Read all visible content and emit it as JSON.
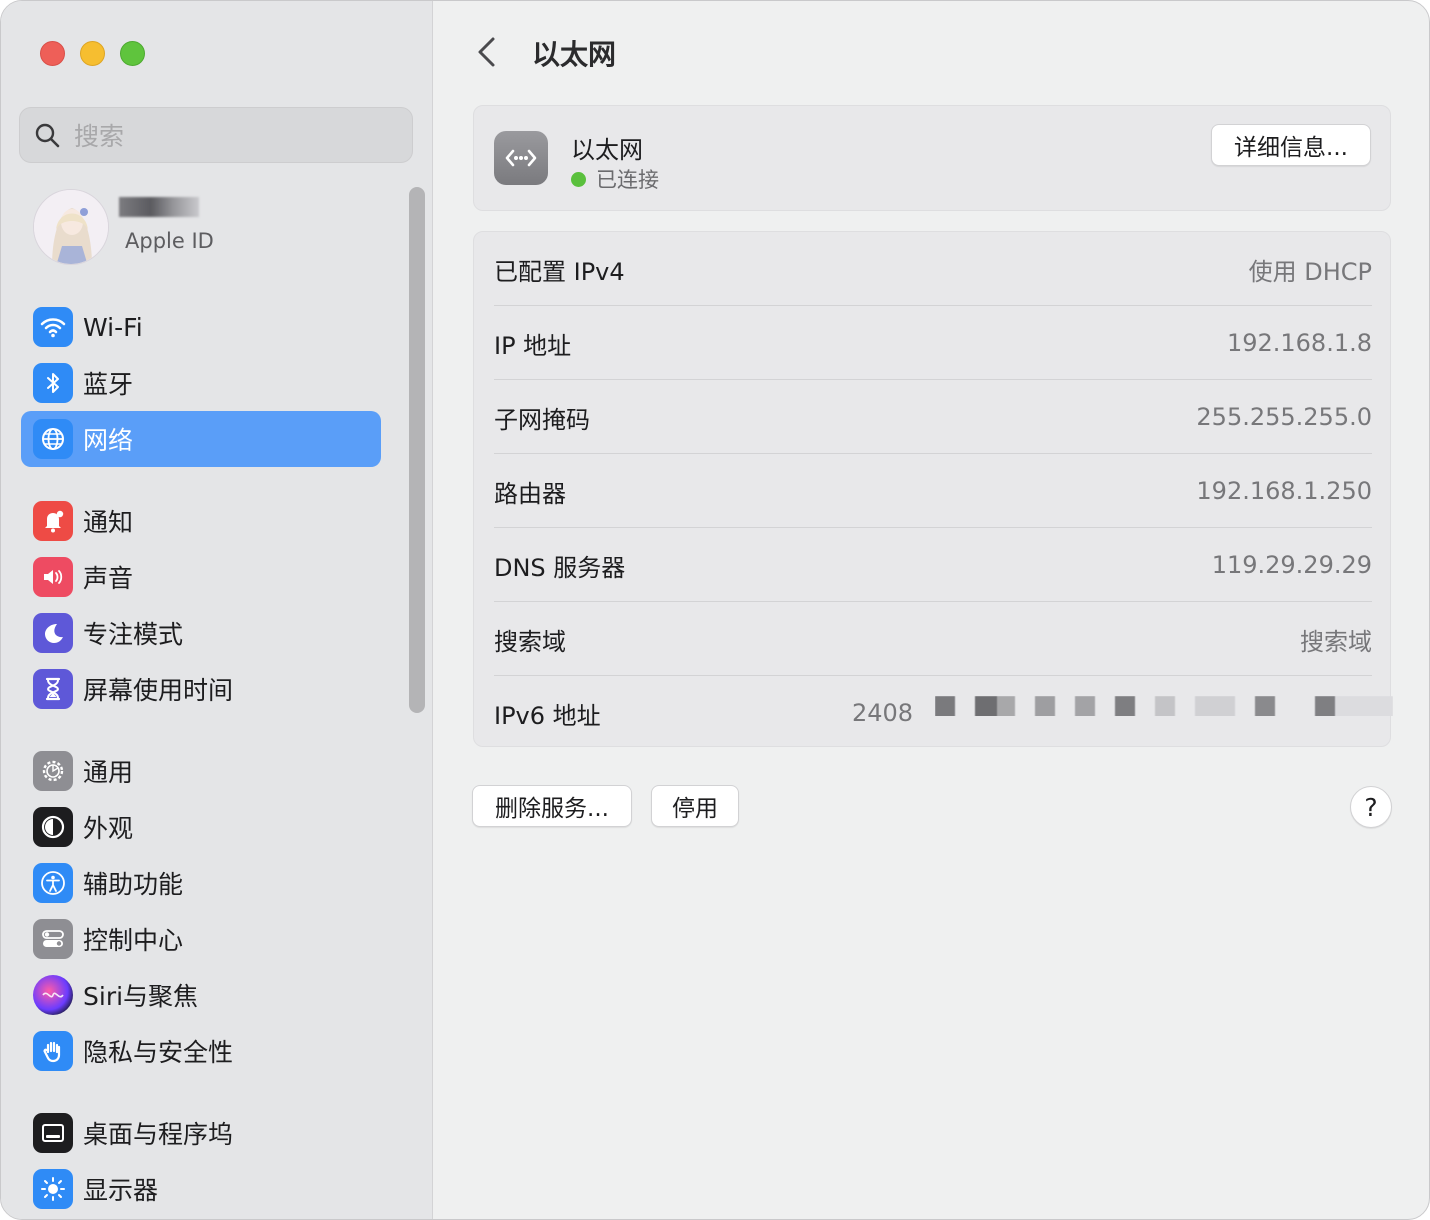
{
  "search": {
    "placeholder": "搜索"
  },
  "account": {
    "subtitle": "Apple ID"
  },
  "sidebar": {
    "group1": [
      {
        "label": "Wi-Fi",
        "icon": "wifi-icon",
        "color": "#2f8bf6",
        "selected": false
      },
      {
        "label": "蓝牙",
        "icon": "bluetooth-icon",
        "color": "#2f8bf6",
        "selected": false
      },
      {
        "label": "网络",
        "icon": "globe-icon",
        "color": "#2f8bf6",
        "selected": true
      }
    ],
    "group2": [
      {
        "label": "通知",
        "icon": "bell-icon",
        "color": "#ee4b45"
      },
      {
        "label": "声音",
        "icon": "speaker-icon",
        "color": "#ee4b62"
      },
      {
        "label": "专注模式",
        "icon": "moon-icon",
        "color": "#5e58d8"
      },
      {
        "label": "屏幕使用时间",
        "icon": "hourglass-icon",
        "color": "#5e58d8"
      }
    ],
    "group3": [
      {
        "label": "通用",
        "icon": "gear-icon",
        "color": "#8e8e93"
      },
      {
        "label": "外观",
        "icon": "appearance-icon",
        "color": "#1d1d1f"
      },
      {
        "label": "辅助功能",
        "icon": "accessibility-icon",
        "color": "#2f8bf6"
      },
      {
        "label": "控制中心",
        "icon": "toggles-icon",
        "color": "#8e8e93"
      },
      {
        "label": "Siri与聚焦",
        "icon": "siri-icon",
        "color": "#2a2a5e"
      },
      {
        "label": "隐私与安全性",
        "icon": "hand-icon",
        "color": "#2f8bf6"
      }
    ],
    "group4": [
      {
        "label": "桌面与程序坞",
        "icon": "dock-icon",
        "color": "#1d1d1f"
      },
      {
        "label": "显示器",
        "icon": "sun-icon",
        "color": "#2f8bf6"
      }
    ]
  },
  "main": {
    "title": "以太网",
    "service": {
      "name": "以太网",
      "status": "已连接",
      "status_color": "#5ac03d",
      "details_label": "详细信息..."
    },
    "rows": [
      {
        "key": "已配置 IPv4",
        "value": "使用 DHCP"
      },
      {
        "key": "IP 地址",
        "value": "192.168.1.8"
      },
      {
        "key": "子网掩码",
        "value": "255.255.255.0"
      },
      {
        "key": "路由器",
        "value": "192.168.1.250"
      },
      {
        "key": "DNS 服务器",
        "value": "119.29.29.29"
      },
      {
        "key": "搜索域",
        "value": "搜索域"
      },
      {
        "key": "IPv6 地址",
        "value": "2408"
      }
    ],
    "delete_label": "删除服务...",
    "disable_label": "停用",
    "help_label": "?"
  }
}
